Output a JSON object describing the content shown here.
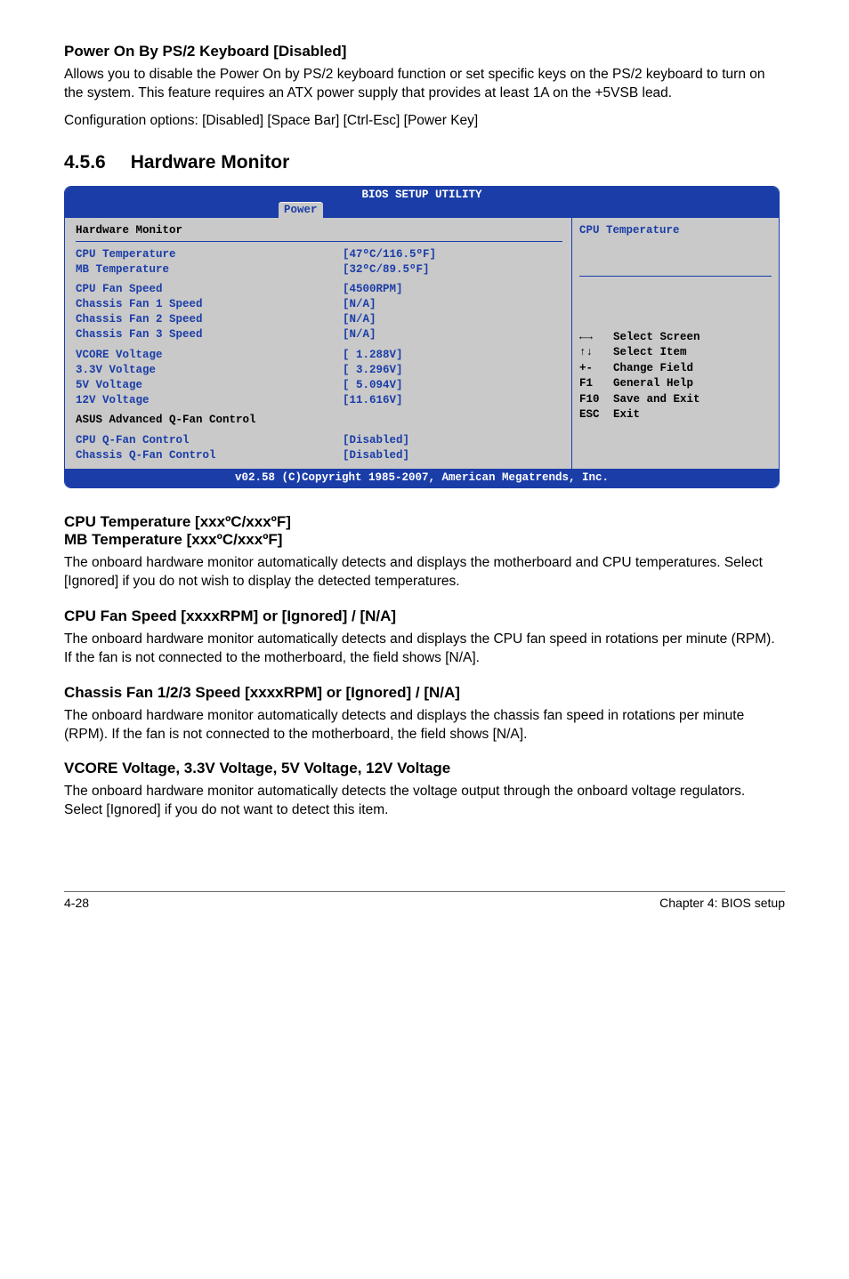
{
  "sec1": {
    "heading": "Power On By PS/2 Keyboard [Disabled]",
    "p1": "Allows you to disable the Power On by PS/2 keyboard function or set specific keys on the PS/2 keyboard to turn on the system. This feature requires an ATX power supply that provides at least 1A on the +5VSB lead.",
    "p2": "Configuration options: [Disabled] [Space Bar] [Ctrl-Esc] [Power Key]"
  },
  "hwmon": {
    "num": "4.5.6",
    "title": "Hardware Monitor"
  },
  "bios": {
    "top": "BIOS SETUP UTILITY",
    "tab": "Power",
    "panel_title": "Hardware Monitor",
    "rows": {
      "cpu_temp_k": "CPU Temperature",
      "cpu_temp_v": "[47ºC/116.5ºF]",
      "mb_temp_k": "MB Temperature",
      "mb_temp_v": "[32ºC/89.5ºF]",
      "cpu_fan_k": "CPU Fan Speed",
      "cpu_fan_v": "[4500RPM]",
      "ch1_k": "Chassis Fan 1 Speed",
      "ch1_v": "[N/A]",
      "ch2_k": "Chassis Fan 2 Speed",
      "ch2_v": "[N/A]",
      "ch3_k": "Chassis Fan 3 Speed",
      "ch3_v": "[N/A]",
      "vcore_k": "VCORE Voltage",
      "vcore_v": "[ 1.288V]",
      "v33_k": "3.3V  Voltage",
      "v33_v": "[ 3.296V]",
      "v5_k": "5V    Voltage",
      "v5_v": "[ 5.094V]",
      "v12_k": "12V   Voltage",
      "v12_v": "[11.616V]",
      "adv_k": "ASUS Advanced Q-Fan Control",
      "cpuq_k": "CPU Q-Fan Control",
      "cpuq_v": "[Disabled]",
      "chq_k": "Chassis Q-Fan Control",
      "chq_v": "[Disabled]"
    },
    "right_title": "CPU Temperature",
    "help": {
      "r1s": "←→",
      "r1t": "Select Screen",
      "r2s": "↑↓",
      "r2t": "Select Item",
      "r3s": "+-",
      "r3t": "Change Field",
      "r4s": "F1",
      "r4t": "General Help",
      "r5s": "F10",
      "r5t": "Save and Exit",
      "r6s": "ESC",
      "r6t": "Exit"
    },
    "footer": "v02.58 (C)Copyright 1985-2007, American Megatrends, Inc."
  },
  "sec2": {
    "h1": "CPU Temperature [xxxºC/xxxºF]",
    "h2": "MB Temperature [xxxºC/xxxºF]",
    "p": "The onboard hardware monitor automatically detects and displays the motherboard and CPU temperatures. Select [Ignored] if you do not wish to display the detected temperatures."
  },
  "sec3": {
    "h": "CPU Fan Speed [xxxxRPM] or [Ignored] / [N/A]",
    "p": "The onboard hardware monitor automatically detects and displays the CPU fan speed in rotations per minute (RPM). If the fan is not connected to the motherboard, the field shows [N/A]."
  },
  "sec4": {
    "h": "Chassis Fan 1/2/3 Speed [xxxxRPM] or [Ignored] / [N/A]",
    "p": "The onboard hardware monitor automatically detects and displays the chassis fan speed in rotations per minute (RPM). If the fan is not connected to the motherboard, the field shows [N/A]."
  },
  "sec5": {
    "h": "VCORE Voltage, 3.3V Voltage, 5V Voltage, 12V Voltage",
    "p": "The onboard hardware monitor automatically detects the voltage output through the onboard voltage regulators. Select [Ignored] if you do not want to detect this item."
  },
  "footer": {
    "left": "4-28",
    "right": "Chapter 4: BIOS setup"
  }
}
